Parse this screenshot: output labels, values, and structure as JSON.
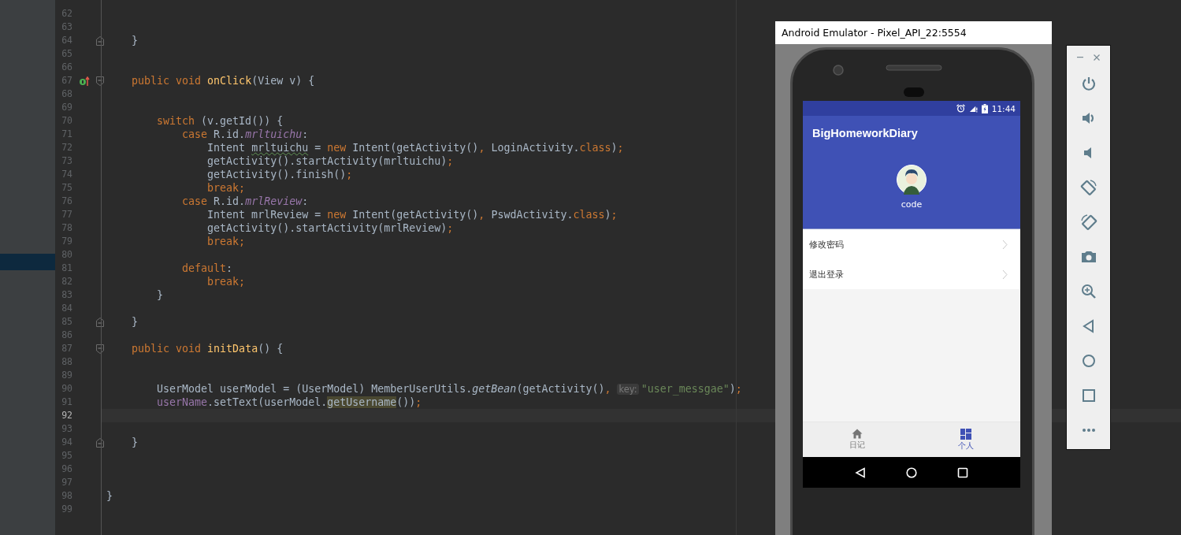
{
  "editor": {
    "lines": [
      {
        "number": "62",
        "fold_start": false,
        "fold_end": false,
        "override": false,
        "current": false
      },
      {
        "number": "63",
        "fold_start": false,
        "fold_end": false,
        "override": false,
        "current": false
      },
      {
        "number": "64",
        "fold_start": false,
        "fold_end": true,
        "override": false,
        "current": false,
        "tokens": [
          {
            "text": "    }",
            "kind": "plain"
          }
        ]
      },
      {
        "number": "65",
        "fold_start": false,
        "fold_end": false,
        "override": false,
        "current": false
      },
      {
        "number": "66",
        "fold_start": false,
        "fold_end": false,
        "override": false,
        "current": false
      },
      {
        "number": "67",
        "fold_start": true,
        "fold_end": false,
        "override": true,
        "current": false,
        "tokens": [
          {
            "text": "    public void ",
            "kind": "keyword"
          },
          {
            "text": "onClick",
            "kind": "decl"
          },
          {
            "text": "(View v) {",
            "kind": "plain"
          }
        ]
      },
      {
        "number": "68",
        "fold_start": false,
        "fold_end": false,
        "override": false,
        "current": false
      },
      {
        "number": "69",
        "fold_start": false,
        "fold_end": false,
        "override": false,
        "current": false
      },
      {
        "number": "70",
        "fold_start": false,
        "fold_end": false,
        "override": false,
        "current": false,
        "tokens": [
          {
            "text": "        switch",
            "kind": "keyword"
          },
          {
            "text": " (v.getId()) {",
            "kind": "plain"
          }
        ]
      },
      {
        "number": "71",
        "fold_start": false,
        "fold_end": false,
        "override": false,
        "current": false,
        "tokens": [
          {
            "text": "            case",
            "kind": "keyword"
          },
          {
            "text": " R.id.",
            "kind": "plain"
          },
          {
            "text": "mrltuichu",
            "kind": "static-field"
          },
          {
            "text": ":",
            "kind": "plain"
          }
        ]
      },
      {
        "number": "72",
        "fold_start": false,
        "fold_end": false,
        "override": false,
        "current": false,
        "tokens": [
          {
            "text": "                Intent ",
            "kind": "plain"
          },
          {
            "text": "mrltuichu",
            "kind": "typo"
          },
          {
            "text": " = ",
            "kind": "plain"
          },
          {
            "text": "new",
            "kind": "keyword"
          },
          {
            "text": " Intent(getActivity()",
            "kind": "plain"
          },
          {
            "text": ", ",
            "kind": "keyword"
          },
          {
            "text": "LoginActivity.",
            "kind": "plain"
          },
          {
            "text": "class",
            "kind": "keyword"
          },
          {
            "text": ")",
            "kind": "plain"
          },
          {
            "text": ";",
            "kind": "keyword"
          }
        ]
      },
      {
        "number": "73",
        "fold_start": false,
        "fold_end": false,
        "override": false,
        "current": false,
        "tokens": [
          {
            "text": "                getActivity().startActivity(mrltuichu)",
            "kind": "plain"
          },
          {
            "text": ";",
            "kind": "keyword"
          }
        ]
      },
      {
        "number": "74",
        "fold_start": false,
        "fold_end": false,
        "override": false,
        "current": false,
        "tokens": [
          {
            "text": "                getActivity().finish()",
            "kind": "plain"
          },
          {
            "text": ";",
            "kind": "keyword"
          }
        ]
      },
      {
        "number": "75",
        "fold_start": false,
        "fold_end": false,
        "override": false,
        "current": false,
        "tokens": [
          {
            "text": "                break;",
            "kind": "keyword"
          }
        ]
      },
      {
        "number": "76",
        "fold_start": false,
        "fold_end": false,
        "override": false,
        "current": false,
        "tokens": [
          {
            "text": "            case",
            "kind": "keyword"
          },
          {
            "text": " R.id.",
            "kind": "plain"
          },
          {
            "text": "mrlReview",
            "kind": "static-field"
          },
          {
            "text": ":",
            "kind": "plain"
          }
        ]
      },
      {
        "number": "77",
        "fold_start": false,
        "fold_end": false,
        "override": false,
        "current": false,
        "tokens": [
          {
            "text": "                Intent mrlReview = ",
            "kind": "plain"
          },
          {
            "text": "new",
            "kind": "keyword"
          },
          {
            "text": " Intent(getActivity()",
            "kind": "plain"
          },
          {
            "text": ", ",
            "kind": "keyword"
          },
          {
            "text": "PswdActivity.",
            "kind": "plain"
          },
          {
            "text": "class",
            "kind": "keyword"
          },
          {
            "text": ")",
            "kind": "plain"
          },
          {
            "text": ";",
            "kind": "keyword"
          }
        ]
      },
      {
        "number": "78",
        "fold_start": false,
        "fold_end": false,
        "override": false,
        "current": false,
        "tokens": [
          {
            "text": "                getActivity().startActivity(mrlReview)",
            "kind": "plain"
          },
          {
            "text": ";",
            "kind": "keyword"
          }
        ]
      },
      {
        "number": "79",
        "fold_start": false,
        "fold_end": false,
        "override": false,
        "current": false,
        "tokens": [
          {
            "text": "                break;",
            "kind": "keyword"
          }
        ]
      },
      {
        "number": "80",
        "fold_start": false,
        "fold_end": false,
        "override": false,
        "current": false
      },
      {
        "number": "81",
        "fold_start": false,
        "fold_end": false,
        "override": false,
        "current": false,
        "tokens": [
          {
            "text": "            default",
            "kind": "keyword"
          },
          {
            "text": ":",
            "kind": "plain"
          }
        ]
      },
      {
        "number": "82",
        "fold_start": false,
        "fold_end": false,
        "override": false,
        "current": false,
        "tokens": [
          {
            "text": "                break;",
            "kind": "keyword"
          }
        ]
      },
      {
        "number": "83",
        "fold_start": false,
        "fold_end": false,
        "override": false,
        "current": false,
        "tokens": [
          {
            "text": "        }",
            "kind": "plain"
          }
        ]
      },
      {
        "number": "84",
        "fold_start": false,
        "fold_end": false,
        "override": false,
        "current": false
      },
      {
        "number": "85",
        "fold_start": false,
        "fold_end": true,
        "override": false,
        "current": false,
        "tokens": [
          {
            "text": "    }",
            "kind": "plain"
          }
        ]
      },
      {
        "number": "86",
        "fold_start": false,
        "fold_end": false,
        "override": false,
        "current": false
      },
      {
        "number": "87",
        "fold_start": true,
        "fold_end": false,
        "override": false,
        "current": false,
        "tokens": [
          {
            "text": "    public void ",
            "kind": "keyword"
          },
          {
            "text": "initData",
            "kind": "decl"
          },
          {
            "text": "() {",
            "kind": "plain"
          }
        ]
      },
      {
        "number": "88",
        "fold_start": false,
        "fold_end": false,
        "override": false,
        "current": false
      },
      {
        "number": "89",
        "fold_start": false,
        "fold_end": false,
        "override": false,
        "current": false
      },
      {
        "number": "90",
        "fold_start": false,
        "fold_end": false,
        "override": false,
        "current": false,
        "tokens": [
          {
            "text": "        UserModel userModel = (UserModel) MemberUserUtils.",
            "kind": "plain"
          },
          {
            "text": "getBean",
            "kind": "static"
          },
          {
            "text": "(getActivity()",
            "kind": "plain"
          },
          {
            "text": ", ",
            "kind": "keyword"
          },
          {
            "text": "key:",
            "kind": "hint"
          },
          {
            "text": "\"user_messgae\"",
            "kind": "string"
          },
          {
            "text": ")",
            "kind": "plain"
          },
          {
            "text": ";",
            "kind": "keyword"
          }
        ]
      },
      {
        "number": "91",
        "fold_start": false,
        "fold_end": false,
        "override": false,
        "current": false,
        "tokens": [
          {
            "text": "        userName",
            "kind": "field"
          },
          {
            "text": ".setText(userModel.",
            "kind": "plain"
          },
          {
            "text": "getUsername",
            "kind": "match"
          },
          {
            "text": "())",
            "kind": "plain"
          },
          {
            "text": ";",
            "kind": "keyword"
          }
        ]
      },
      {
        "number": "92",
        "fold_start": false,
        "fold_end": false,
        "override": false,
        "current": true
      },
      {
        "number": "93",
        "fold_start": false,
        "fold_end": false,
        "override": false,
        "current": false
      },
      {
        "number": "94",
        "fold_start": false,
        "fold_end": true,
        "override": false,
        "current": false,
        "tokens": [
          {
            "text": "    }",
            "kind": "plain"
          }
        ]
      },
      {
        "number": "95",
        "fold_start": false,
        "fold_end": false,
        "override": false,
        "current": false
      },
      {
        "number": "96",
        "fold_start": false,
        "fold_end": false,
        "override": false,
        "current": false
      },
      {
        "number": "97",
        "fold_start": false,
        "fold_end": false,
        "override": false,
        "current": false
      },
      {
        "number": "98",
        "fold_start": false,
        "fold_end": false,
        "override": false,
        "current": false,
        "tokens": [
          {
            "text": "}",
            "kind": "plain"
          }
        ]
      },
      {
        "number": "99",
        "fold_start": false,
        "fold_end": false,
        "override": false,
        "current": false
      }
    ]
  },
  "emulator": {
    "title": "Android Emulator - Pixel_API_22:5554",
    "status_bar": {
      "time": "11:44"
    },
    "app_bar": {
      "title": "BigHomeworkDiary"
    },
    "profile": {
      "name": "code"
    },
    "menu": [
      {
        "label": "修改密码"
      },
      {
        "label": "退出登录"
      }
    ],
    "bottom_nav": [
      {
        "label": "日记",
        "selected": false
      },
      {
        "label": "个人",
        "selected": true
      }
    ]
  }
}
